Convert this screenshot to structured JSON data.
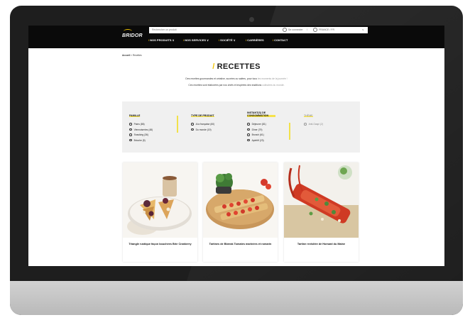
{
  "header": {
    "logo": "BRIDOR",
    "search_placeholder": "Rechercher un produit",
    "login": "Se connecter",
    "separator": "/",
    "locale": "FRANCE / FR",
    "locale_caret": "∨",
    "nav": [
      {
        "slash": "/",
        "label": "NOS PRODUITS ∨"
      },
      {
        "slash": "/",
        "label": "NOS SERVICES ∨"
      },
      {
        "slash": "/",
        "label": "SOCIÉTÉ ∨"
      },
      {
        "slash": "/",
        "label": "CARRIÈRES"
      },
      {
        "slash": "/",
        "label": "CONTACT"
      }
    ]
  },
  "breadcrumb": {
    "home": "Accueil",
    "sep": ">",
    "current": "Recettes"
  },
  "page_title": {
    "slash": "/",
    "text": "RECETTES"
  },
  "intro": {
    "line1_main": "Des recettes gourmandes et créative, sucrées ou salées, pour tous",
    "line1_light": " les moments de la journée !",
    "line2_main": "Ces recettes sont élaborées par nos chefs et inspirées des traditions",
    "line2_light": " culinaires du monde."
  },
  "filters": [
    {
      "title": "FAMILLE",
      "options": [
        "Pains (86)",
        "Viennoiseries (48)",
        "Snacking (36)",
        "Brioche (5)"
      ]
    },
    {
      "title": "TYPE DE PRODUIT",
      "options": [
        "A la française (60)",
        "Du monde (19)"
      ]
    },
    {
      "title": "INSTANT(S) DE CONSOMMATION",
      "options": [
        "Déjeuner (81)",
        "Dîner (79)",
        "Brunch (61)",
        "Apéritif (23)"
      ]
    },
    {
      "title": "THÈME",
      "options": [
        "Anti-Gaspi (2)"
      ]
    }
  ],
  "recipes": [
    {
      "title": "Triangle rustique façon bouchées Brie Cranberry"
    },
    {
      "title": "Tartines de Bbreak Tomates marinées et romarin"
    },
    {
      "title": "Tartine revisitée de Homard du Maine"
    }
  ],
  "colors": {
    "accent": "#f2c500",
    "header_bg": "#0a0a0a",
    "filters_bg": "#f0f0f0"
  }
}
